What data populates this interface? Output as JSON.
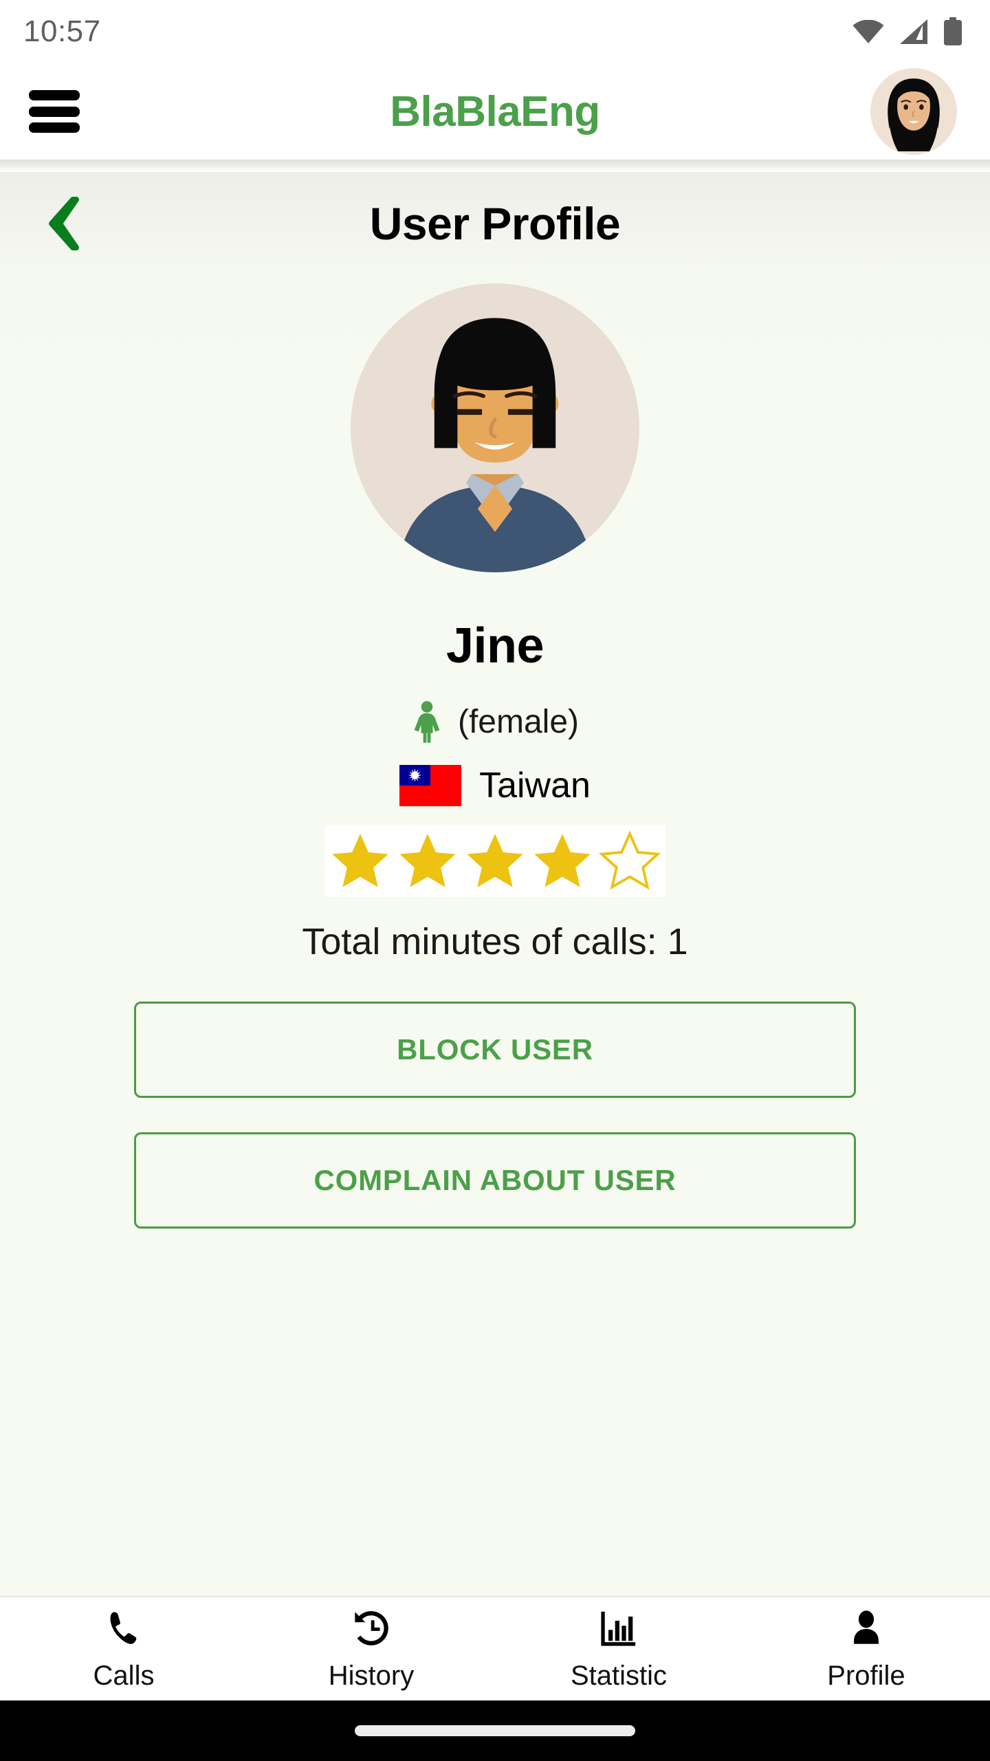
{
  "status_bar": {
    "time": "10:57",
    "icons": [
      "wifi-icon",
      "cellular-signal-icon",
      "battery-icon"
    ]
  },
  "app_header": {
    "menu_icon": "hamburger-menu-icon",
    "brand": "BlaBlaEng",
    "brand_color": "#4ba049",
    "avatar_icon": "user-avatar-hijab"
  },
  "page": {
    "back_icon": "chevron-left-icon",
    "back_icon_color": "#0a7d1e",
    "title": "User Profile",
    "background_color": "#f7faf1"
  },
  "profile": {
    "avatar_icon": "profile-avatar-woman-bob",
    "name": "Jine",
    "gender_icon": "female-figure-icon",
    "gender_label": "(female)",
    "gender_icon_color": "#4ba049",
    "country_flag": "taiwan-flag-icon",
    "country": "Taiwan",
    "rating": 4,
    "rating_max": 5,
    "star_color": "#edc211",
    "total_minutes_label": "Total minutes of calls: 1"
  },
  "actions": {
    "block_label": "BLOCK USER",
    "complain_label": "COMPLAIN ABOUT USER",
    "accent_color": "#4ba049"
  },
  "bottom_nav": {
    "items": [
      {
        "label": "Calls",
        "icon": "phone-icon"
      },
      {
        "label": "History",
        "icon": "history-clock-icon"
      },
      {
        "label": "Statistic",
        "icon": "bar-chart-icon"
      },
      {
        "label": "Profile",
        "icon": "person-icon"
      }
    ]
  }
}
